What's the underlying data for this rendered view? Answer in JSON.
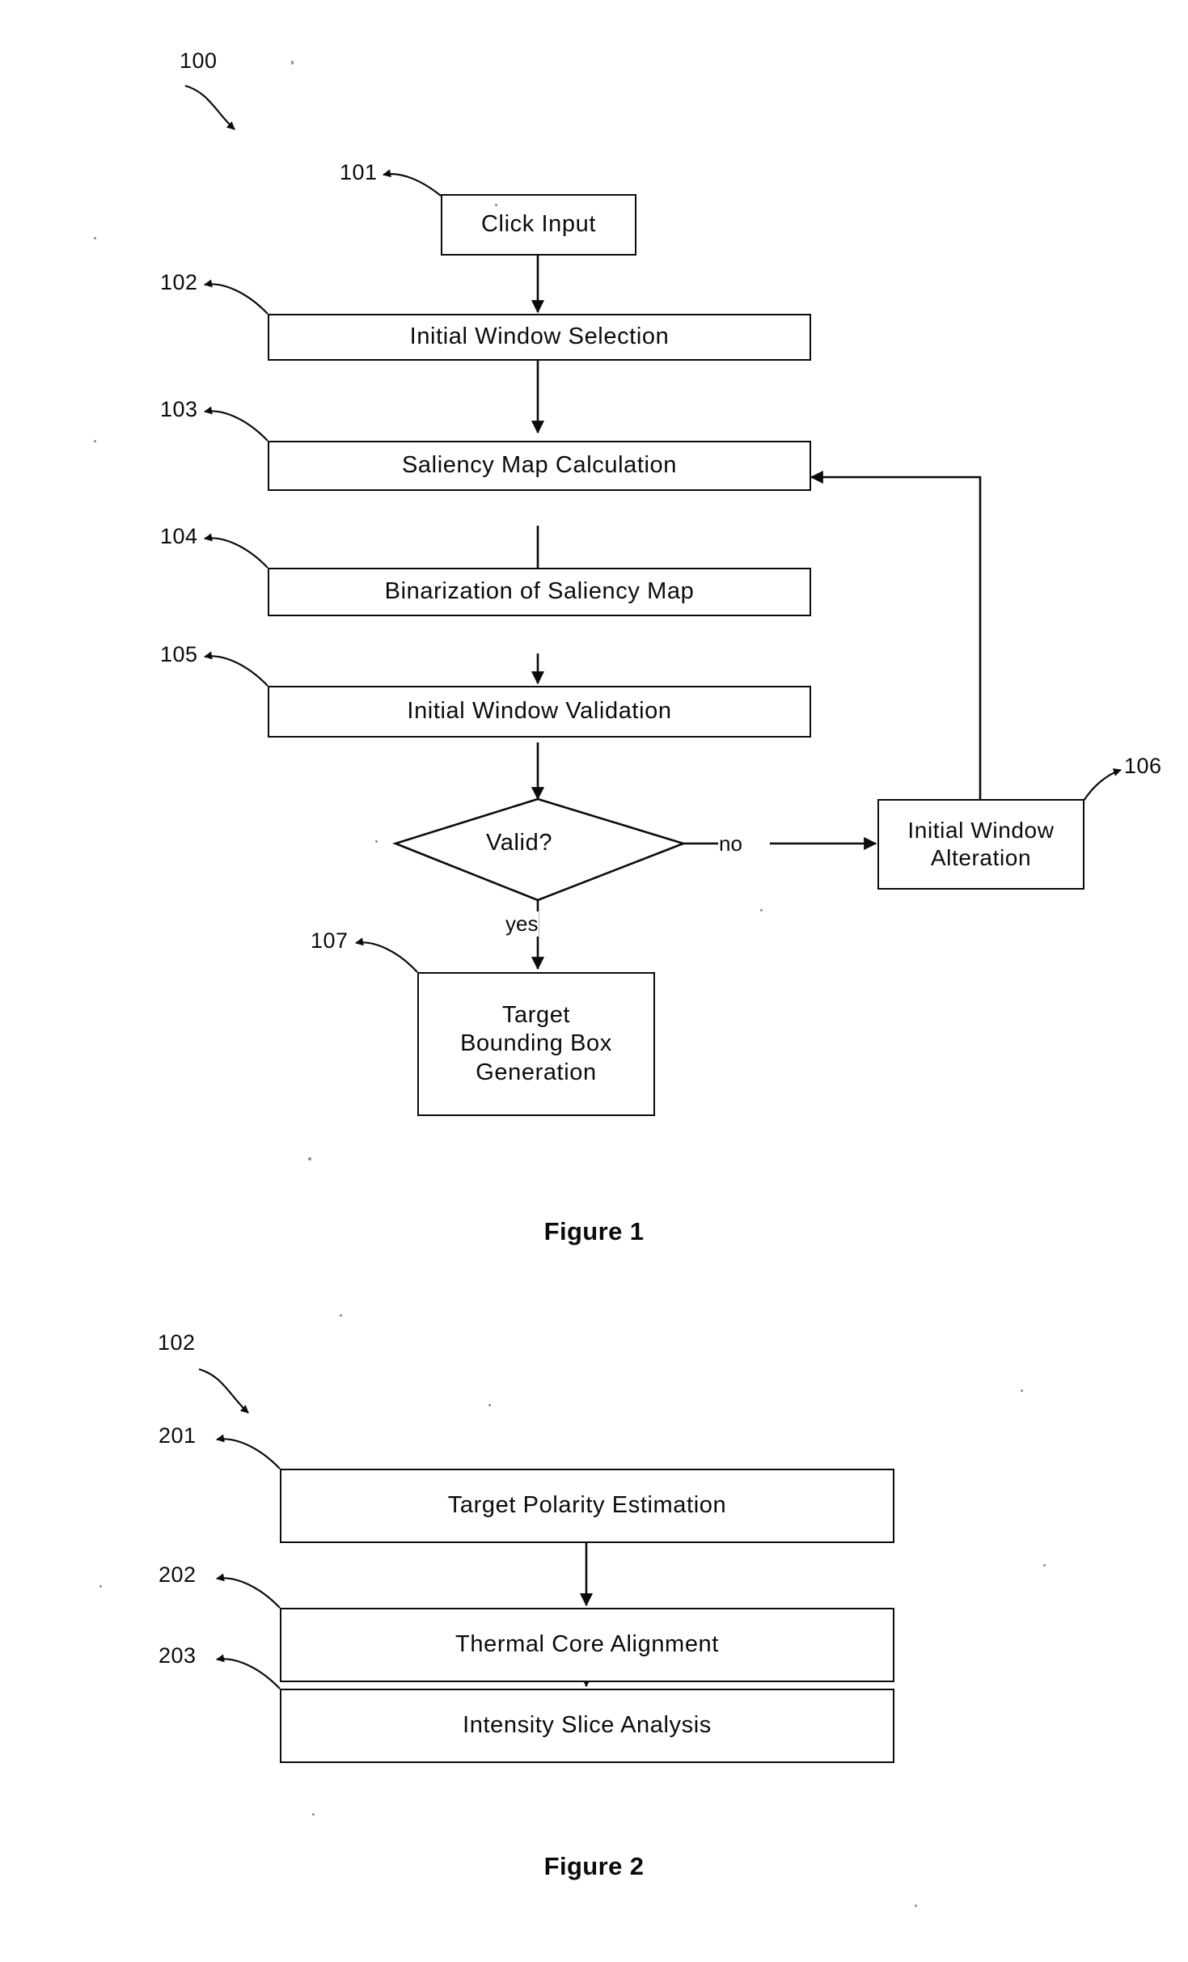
{
  "document": {
    "kind": "patent-drawing-sheet",
    "background_color": "#ffffff",
    "ink_color": "#0b0b0b"
  },
  "figure1": {
    "caption": "Figure 1",
    "overall_ref": "100",
    "nodes": [
      {
        "ref": "101",
        "label": "Click Input",
        "shape": "rect"
      },
      {
        "ref": "102",
        "label": "Initial Window Selection",
        "shape": "rect"
      },
      {
        "ref": "103",
        "label": "Saliency Map Calculation",
        "shape": "rect"
      },
      {
        "ref": "104",
        "label": "Binarization of Saliency Map",
        "shape": "rect"
      },
      {
        "ref": "105",
        "label": "Initial Window Validation",
        "shape": "rect"
      },
      {
        "ref": "",
        "label": "Valid?",
        "shape": "diamond"
      },
      {
        "ref": "106",
        "label": "Initial Window\nAlteration",
        "shape": "rect"
      },
      {
        "ref": "107",
        "label": "Target\nBounding Box\nGeneration",
        "shape": "rect"
      }
    ],
    "edge_labels": {
      "no": "no",
      "yes": "yes"
    }
  },
  "figure2": {
    "caption": "Figure 2",
    "overall_ref": "102",
    "nodes": [
      {
        "ref": "201",
        "label": "Target Polarity Estimation"
      },
      {
        "ref": "202",
        "label": "Thermal Core Alignment"
      },
      {
        "ref": "203",
        "label": "Intensity Slice Analysis"
      }
    ]
  }
}
